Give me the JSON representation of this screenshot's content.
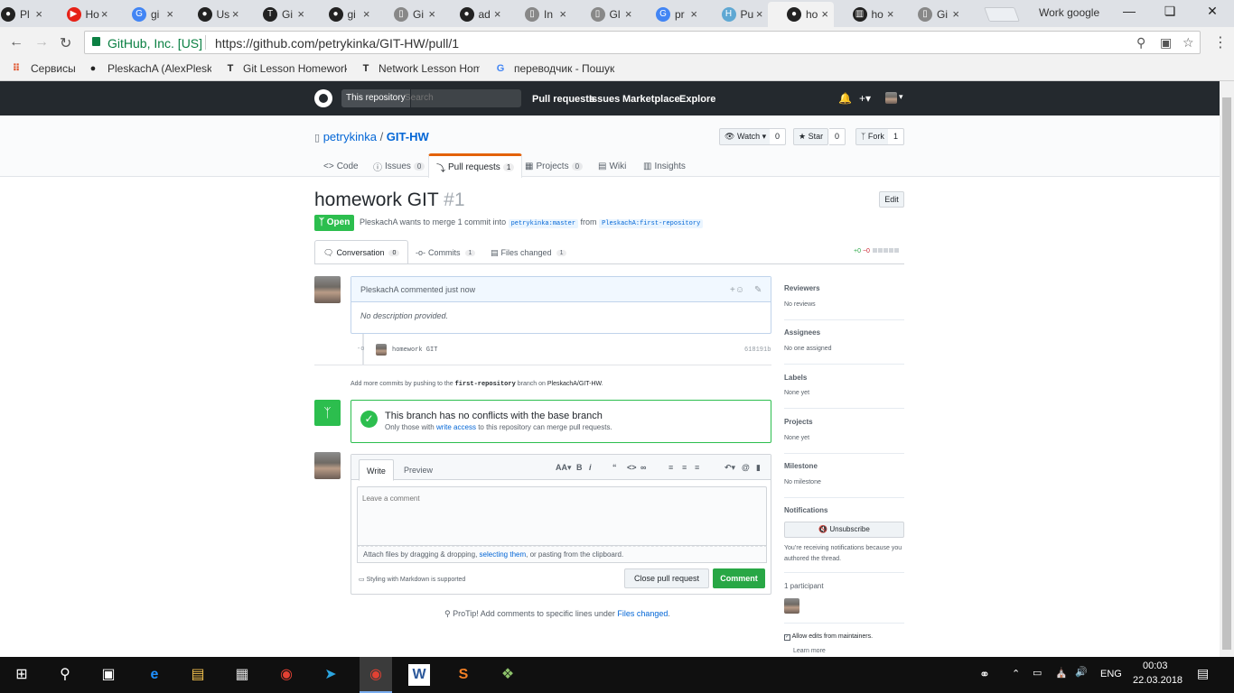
{
  "browser": {
    "tabs": [
      {
        "title": "Pl",
        "favicon": "github-icon",
        "color": "#222"
      },
      {
        "title": "Ho",
        "favicon": "youtube-icon",
        "color": "#e62117"
      },
      {
        "title": "gi",
        "favicon": "google-icon",
        "color": "#4285f4"
      },
      {
        "title": "Us",
        "favicon": "github-icon",
        "color": "#222"
      },
      {
        "title": "Gi",
        "favicon": "trello-t-icon",
        "color": "#222"
      },
      {
        "title": "gi",
        "favicon": "github-icon",
        "color": "#222"
      },
      {
        "title": "Gi",
        "favicon": "document-icon",
        "color": "#888"
      },
      {
        "title": "ad",
        "favicon": "github-icon",
        "color": "#222"
      },
      {
        "title": "In",
        "favicon": "document-icon",
        "color": "#888"
      },
      {
        "title": "Gl",
        "favicon": "document-icon",
        "color": "#888"
      },
      {
        "title": "pr",
        "favicon": "google-icon",
        "color": "#4285f4"
      },
      {
        "title": "Pu",
        "favicon": "h-icon",
        "color": "#5fa8d3"
      },
      {
        "title": "ho",
        "favicon": "github-icon",
        "color": "#222"
      },
      {
        "title": "ho",
        "favicon": "trello-icon",
        "color": "#222"
      },
      {
        "title": "Gi",
        "favicon": "document-icon",
        "color": "#888"
      }
    ],
    "active_tab": 12,
    "profile": "Work google",
    "secure_label": "GitHub, Inc. [US]",
    "url": "https://github.com/petrykinka/GIT-HW/pull/1",
    "bookmarks": [
      {
        "label": "Сервисы",
        "icon": "apps-grid-icon"
      },
      {
        "label": "PleskachA (AlexPleskach)",
        "icon": "github-icon"
      },
      {
        "label": "Git Lesson Homework",
        "icon": "t-icon"
      },
      {
        "label": "Network Lesson Hom",
        "icon": "t-icon"
      },
      {
        "label": "переводчик - Пошук",
        "icon": "google-icon"
      }
    ]
  },
  "header": {
    "scope": "This repository",
    "search_placeholder": "Search",
    "nav": [
      "Pull requests",
      "Issues",
      "Marketplace",
      "Explore"
    ]
  },
  "repo": {
    "owner": "petrykinka",
    "name": "GIT-HW",
    "watch": {
      "label": "Watch",
      "count": "0"
    },
    "star": {
      "label": "Star",
      "count": "0"
    },
    "fork": {
      "label": "Fork",
      "count": "1"
    },
    "tabs": [
      {
        "label": "Code",
        "icon": "<>"
      },
      {
        "label": "Issues",
        "count": "0",
        "icon": "ⓘ"
      },
      {
        "label": "Pull requests",
        "count": "1",
        "icon": "⤵"
      },
      {
        "label": "Projects",
        "count": "0",
        "icon": "▦"
      },
      {
        "label": "Wiki",
        "icon": "▤"
      },
      {
        "label": "Insights",
        "icon": "▥"
      }
    ]
  },
  "pr": {
    "title": "homework GIT",
    "number": "#1",
    "edit": "Edit",
    "state": "Open",
    "author": "PleskachA",
    "meta_mid": "wants to merge 1 commit into",
    "base": "petrykinka:master",
    "from": "from",
    "head": "PleskachA:first-repository",
    "tabs": [
      {
        "label": "Conversation",
        "count": "0"
      },
      {
        "label": "Commits",
        "count": "1"
      },
      {
        "label": "Files changed",
        "count": "1"
      }
    ],
    "diff_add": "+0",
    "diff_del": "−0"
  },
  "timeline": {
    "comment_author": "PleskachA",
    "comment_action": "commented just now",
    "comment_body": "No description provided.",
    "commit_message": "homework GIT",
    "commit_sha": "618191b",
    "push_hint_pre": "Add more commits by pushing to the",
    "push_hint_branch": "first-repository",
    "push_hint_mid": "branch on",
    "push_hint_repo": "PleskachA/GIT-HW",
    "merge_title": "This branch has no conflicts with the base branch",
    "merge_sub_pre": "Only those with",
    "merge_sub_link": "write access",
    "merge_sub_post": "to this repository can merge pull requests."
  },
  "form": {
    "tab_write": "Write",
    "tab_preview": "Preview",
    "placeholder": "Leave a comment",
    "attach_pre": "Attach files by dragging & dropping,",
    "attach_link": "selecting them",
    "attach_post": ", or pasting from the clipboard.",
    "markdown_hint": "Styling with Markdown is supported",
    "close_button": "Close pull request",
    "comment_button": "Comment",
    "protip_pre": "ProTip! Add comments to specific lines under",
    "protip_link": "Files changed",
    "protip_post": "."
  },
  "sidebar": {
    "reviewers_h": "Reviewers",
    "reviewers_v": "No reviews",
    "assignees_h": "Assignees",
    "assignees_v": "No one assigned",
    "labels_h": "Labels",
    "labels_v": "None yet",
    "projects_h": "Projects",
    "projects_v": "None yet",
    "milestone_h": "Milestone",
    "milestone_v": "No milestone",
    "notifications_h": "Notifications",
    "unsubscribe": "Unsubscribe",
    "notif_reason": "You’re receiving notifications because you authored the thread.",
    "participants": "1 participant",
    "allow_edits": "Allow edits from maintainers.",
    "learn_more": "Learn more"
  },
  "taskbar": {
    "lang": "ENG",
    "time": "00:03",
    "date": "22.03.2018"
  }
}
